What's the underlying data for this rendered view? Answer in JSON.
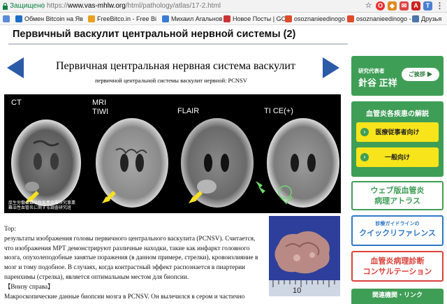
{
  "browser": {
    "security_label": "Защищено",
    "url_scheme": "https://",
    "url_host": "www.vas-mhlw.org",
    "url_path": "/html/pathology/atlas/17-2.html",
    "bookmarks": [
      {
        "label": "Обмен Bitcoin на Яв",
        "color": "#1f6fc5"
      },
      {
        "label": "FreeBitco.in - Free Bi",
        "color": "#e8a021"
      },
      {
        "label": "Михаил Агальнов",
        "color": "#3a7bd5"
      },
      {
        "label": "Новое Посты | GOL",
        "color": "#c33"
      },
      {
        "label": "osoznanieedinogo -",
        "color": "#e04b2a"
      },
      {
        "label": "osoznanieedinogo -",
        "color": "#e04b2a"
      },
      {
        "label": "Друзья",
        "color": "#4a76a8"
      }
    ]
  },
  "page": {
    "header_title": "Первичный васкулит центральной нервной системы (2)",
    "title": "Первичная центральная нервная система васкулит",
    "subtitle": "первичной центральной системы васкулит нервной: PCNSV",
    "scan_labels": [
      "CT",
      "MRI\nTIWI",
      "FLAIR",
      "TI CE(+)"
    ],
    "scan_caption": [
      "厚生労働省難治性疾患克服研究事業",
      "難治性血管炎に関する調査研究班"
    ],
    "biopsy_scale": "10",
    "desc_lines": [
      "Top:",
      "результаты изображения головы первичного центрального васкулита (PCNSV). Считается,",
      "что изображения МРТ демонстрируют различные находки, такие как инфаркт головного",
      "мозга, опухолеподобные занятые поражения (в данном примере, стрелки), кровоизлияние в",
      "мозг и тому подобное. В случаях, когда контрастный эффект распознается в пиартерии",
      "паренхимы (стрелка), является оптимальным местом для биопсии.",
      "【Внизу справа】",
      "Макроскопические данные биопсии мозга в PCNSV. Он вылечился в сером и частично"
    ]
  },
  "sidebar": {
    "rep_label": "研究代表者",
    "rep_name": "針谷 正祥",
    "greet_button": "ご挨拶 ▶",
    "explain_header": "血管炎各疾患の解説",
    "for_doctors": "医療従事者向け",
    "for_public": "一般向け",
    "atlas_l1": "ウェブ版血管炎",
    "atlas_l2": "病理アトラス",
    "quick_l1": "診療ガイドラインの",
    "quick_l2": "クイックリファレンス",
    "consult_l1": "血管炎病理診断",
    "consult_l2": "コンサルテーション",
    "related": "関連機関・リンク"
  }
}
